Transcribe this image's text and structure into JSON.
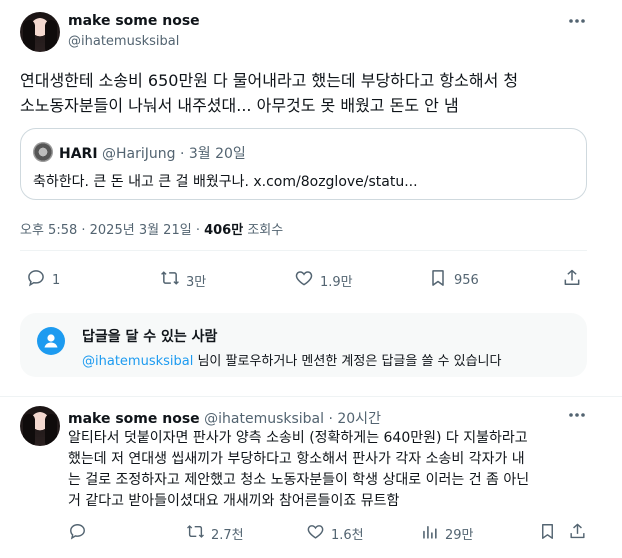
{
  "main_tweet": {
    "display_name": "make some nose",
    "handle": "@ihatemusksibal",
    "text_line1": "연대생한테 소송비 650만원 다 물어내라고 했는데 부당하다고 항소해서 청",
    "text_line2": "소노동자분들이 나눠서 내주셨대... 아무것도 못 배웠고 돈도 안 냄",
    "quote": {
      "display_name": "HARI",
      "handle": "@HariJung",
      "separator": "·",
      "date": "3월 20일",
      "text": "축하한다. 큰 돈 내고 큰 걸 배웠구나. x.com/8ozglove/statu..."
    },
    "meta": {
      "time_date": "오후 5:58 · 2025년 3월 21일 ·",
      "views_count": "406만",
      "views_label": "조회수"
    },
    "actions": {
      "replies": "1",
      "retweets": "3만",
      "likes": "1.9만",
      "bookmarks": "956"
    }
  },
  "reply_permission": {
    "title": "답글을 달 수 있는 사람",
    "handle": "@ihatemusksibal",
    "rest": " 님이 팔로우하거나 멘션한 계정은 답글을 쓸 수 있습니다"
  },
  "reply_tweet": {
    "display_name": "make some nose",
    "handle_time": "@ihatemusksibal · 20시간",
    "lines": [
      "알티타서 덧붙이자면 판사가 양측 소송비 (정확하게는 640만원) 다 지불하라고",
      "했는데 저 연대생 씹새끼가 부당하다고 항소해서 판사가 각자 소송비 각자가 내",
      "는 걸로 조정하자고 제안했고 청소 노동자분들이 학생 상대로 이러는 건 좀 아닌",
      "거 같다고 받아들이셨대요 개새끼와 참어른들이죠 뮤트함"
    ],
    "actions": {
      "retweets": "2.7천",
      "likes": "1.6천",
      "views": "29만"
    }
  },
  "colors": {
    "accent": "#1d9bf0",
    "muted": "#536471",
    "border": "#cfd9de"
  }
}
